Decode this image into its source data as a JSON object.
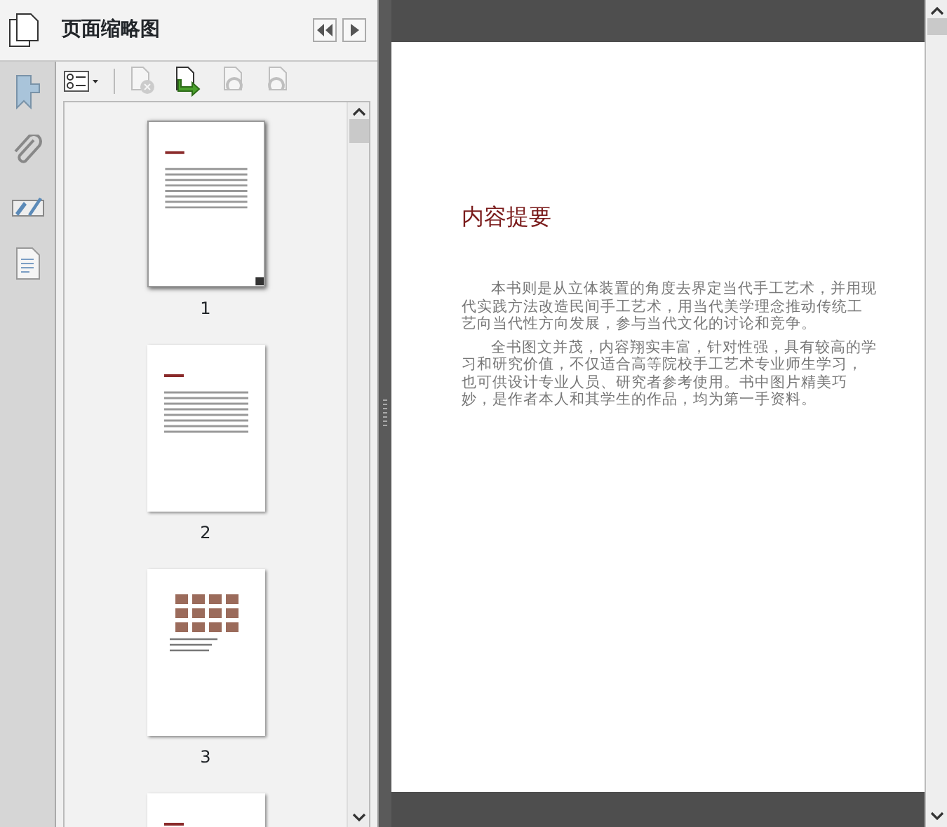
{
  "panel": {
    "title": "页面缩略图"
  },
  "toolbar_buttons": [
    {
      "disabled": true
    },
    {
      "disabled": false
    },
    {
      "disabled": true
    },
    {
      "disabled": true
    }
  ],
  "thumbnails": [
    {
      "label": "1",
      "selected": true,
      "kind": "text"
    },
    {
      "label": "2",
      "selected": false,
      "kind": "text"
    },
    {
      "label": "3",
      "selected": false,
      "kind": "figures"
    },
    {
      "selected": false,
      "kind": "text"
    }
  ],
  "document": {
    "heading": "内容提要",
    "paragraphs": [
      "本书则是从立体装置的角度去界定当代手工艺术，并用现代实践方法改造民间手工艺术，用当代美学理念推动传统工艺向当代性方向发展，参与当代文化的讨论和竞争。",
      "全书图文并茂，内容翔实丰富，针对性强，具有较高的学习和研究价值，不仅适合高等院校手工艺术专业师生学习，也可供设计专业人员、研究者参考使用。书中图片精美巧妙，是作者本人和其学生的作品，均为第一手资料。"
    ]
  }
}
